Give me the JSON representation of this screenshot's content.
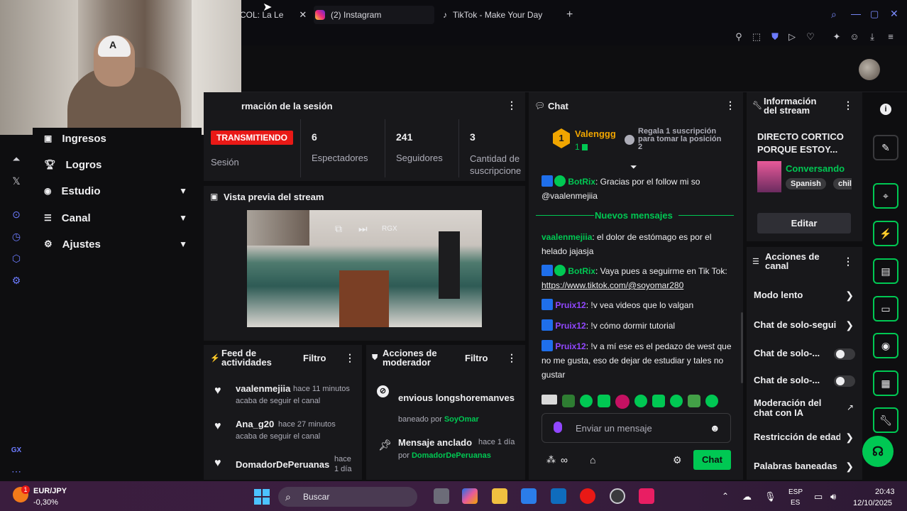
{
  "browser": {
    "tabs": [
      {
        "label": "COL: La Le",
        "active": true
      },
      {
        "label": "(2) Instagram",
        "active": false
      },
      {
        "label": "TikTok - Make Your Day",
        "active": false
      }
    ],
    "new_tab": "+"
  },
  "sidenav": {
    "items": [
      {
        "label": "Ingresos"
      },
      {
        "label": "Logros"
      },
      {
        "label": "Estudio"
      },
      {
        "label": "Canal"
      },
      {
        "label": "Ajustes"
      }
    ]
  },
  "rail": {
    "gx_label": "GX"
  },
  "session": {
    "title": "rmación de la sesión",
    "live_badge": "TRANSMITIENDO",
    "session_label": "Sesión",
    "stats": [
      {
        "value": "6",
        "label": "Espectadores"
      },
      {
        "value": "241",
        "label": "Seguidores"
      },
      {
        "value": "3",
        "label": "Cantidad de suscripcione"
      }
    ]
  },
  "preview": {
    "title": "Vista previa del stream",
    "overlay_label": "RGX"
  },
  "feed": {
    "title": "Feed de actividades",
    "filter": "Filtro",
    "items": [
      {
        "user": "vaalenmejiia",
        "time": "hace 11 minutos",
        "action": "acaba de seguir el canal"
      },
      {
        "user": "Ana_g20",
        "time": "hace 27 minutos",
        "action": "acaba de seguir el canal"
      },
      {
        "user": "DomadorDePeruanas",
        "time": "hace 1 día",
        "action": ""
      }
    ]
  },
  "modactions": {
    "title": "Acciones de moderador",
    "filter": "Filtro",
    "ban_user": "envious longshoremanves",
    "ban_text": "baneado por",
    "ban_by": "SoyOmar",
    "pinned": "Mensaje anclado",
    "pinned_time": "hace 1 día",
    "pinned_by_prefix": "por",
    "pinned_by": "DomadorDePeruanas"
  },
  "chat": {
    "title": "Chat",
    "leader_name": "Valenggg",
    "leader_count": "1",
    "leader_rank": "1",
    "gift_text": "Regala 1 suscripción para tomar la posición 2",
    "messages": [
      {
        "user": "BotRix",
        "text": ": Gracias por el follow mi so @vaalenmejiia"
      },
      {
        "user": "vaalenmejiia",
        "text": ": el dolor de estómago es por el helado jajasja"
      },
      {
        "user": "BotRix",
        "text": ": Vaya pues a seguirme en Tik Tok:"
      },
      {
        "user": "Pruix12",
        "text": ": !v vea videos que lo valgan"
      },
      {
        "user": "Pruix12",
        "text": ": !v cómo dormir tutorial"
      },
      {
        "user": "Pruix12",
        "text": ": !v a mí ese es el pedazo de west que no me gusta, eso de dejar de estudiar y tales no gustar"
      }
    ],
    "link": "https://www.tiktok.com/@soyomar280",
    "new_messages": "Nuevos mensajes",
    "input_placeholder": "Enviar un mensaje",
    "send": "Chat"
  },
  "stream_info": {
    "title": "Información del stream",
    "stream_title": "DIRECTO CORTICO PORQUE ESTOY...",
    "category": "Conversando",
    "tags": [
      "Spanish",
      "chil"
    ],
    "edit": "Editar"
  },
  "channel_actions": {
    "title": "Acciones de canal",
    "items": [
      {
        "label": "Modo lento"
      },
      {
        "label": "Chat de solo-segui"
      },
      {
        "label": "Chat de solo-..."
      },
      {
        "label": "Chat de solo-..."
      },
      {
        "label": "Moderación del chat con IA"
      },
      {
        "label": "Restricción de edad"
      },
      {
        "label": "Palabras baneadas"
      }
    ]
  },
  "taskbar": {
    "pair": "EUR/JPY",
    "change": "-0,30%",
    "ticker_badge": "1",
    "search": "Buscar",
    "lang": "ESP",
    "lang2": "ES",
    "time": "20:43",
    "date": "12/10/2025"
  },
  "colors": {
    "accent": "#00c853",
    "live": "#e91916",
    "purple": "#9147ff",
    "bg": "#0e0e10",
    "panel": "#18181b"
  }
}
